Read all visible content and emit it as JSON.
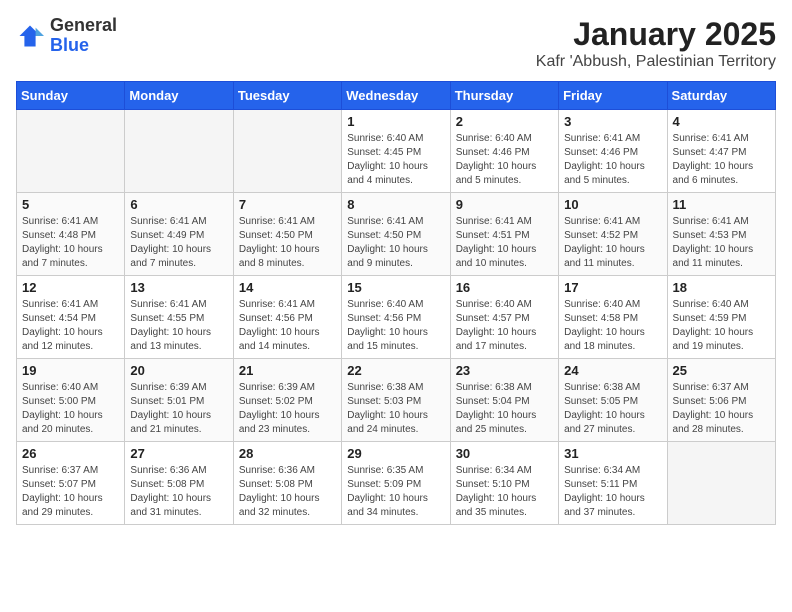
{
  "header": {
    "logo_line1": "General",
    "logo_line2": "Blue",
    "title": "January 2025",
    "subtitle": "Kafr 'Abbush, Palestinian Territory"
  },
  "weekdays": [
    "Sunday",
    "Monday",
    "Tuesday",
    "Wednesday",
    "Thursday",
    "Friday",
    "Saturday"
  ],
  "weeks": [
    [
      {
        "day": "",
        "info": ""
      },
      {
        "day": "",
        "info": ""
      },
      {
        "day": "",
        "info": ""
      },
      {
        "day": "1",
        "info": "Sunrise: 6:40 AM\nSunset: 4:45 PM\nDaylight: 10 hours\nand 4 minutes."
      },
      {
        "day": "2",
        "info": "Sunrise: 6:40 AM\nSunset: 4:46 PM\nDaylight: 10 hours\nand 5 minutes."
      },
      {
        "day": "3",
        "info": "Sunrise: 6:41 AM\nSunset: 4:46 PM\nDaylight: 10 hours\nand 5 minutes."
      },
      {
        "day": "4",
        "info": "Sunrise: 6:41 AM\nSunset: 4:47 PM\nDaylight: 10 hours\nand 6 minutes."
      }
    ],
    [
      {
        "day": "5",
        "info": "Sunrise: 6:41 AM\nSunset: 4:48 PM\nDaylight: 10 hours\nand 7 minutes."
      },
      {
        "day": "6",
        "info": "Sunrise: 6:41 AM\nSunset: 4:49 PM\nDaylight: 10 hours\nand 7 minutes."
      },
      {
        "day": "7",
        "info": "Sunrise: 6:41 AM\nSunset: 4:50 PM\nDaylight: 10 hours\nand 8 minutes."
      },
      {
        "day": "8",
        "info": "Sunrise: 6:41 AM\nSunset: 4:50 PM\nDaylight: 10 hours\nand 9 minutes."
      },
      {
        "day": "9",
        "info": "Sunrise: 6:41 AM\nSunset: 4:51 PM\nDaylight: 10 hours\nand 10 minutes."
      },
      {
        "day": "10",
        "info": "Sunrise: 6:41 AM\nSunset: 4:52 PM\nDaylight: 10 hours\nand 11 minutes."
      },
      {
        "day": "11",
        "info": "Sunrise: 6:41 AM\nSunset: 4:53 PM\nDaylight: 10 hours\nand 11 minutes."
      }
    ],
    [
      {
        "day": "12",
        "info": "Sunrise: 6:41 AM\nSunset: 4:54 PM\nDaylight: 10 hours\nand 12 minutes."
      },
      {
        "day": "13",
        "info": "Sunrise: 6:41 AM\nSunset: 4:55 PM\nDaylight: 10 hours\nand 13 minutes."
      },
      {
        "day": "14",
        "info": "Sunrise: 6:41 AM\nSunset: 4:56 PM\nDaylight: 10 hours\nand 14 minutes."
      },
      {
        "day": "15",
        "info": "Sunrise: 6:40 AM\nSunset: 4:56 PM\nDaylight: 10 hours\nand 15 minutes."
      },
      {
        "day": "16",
        "info": "Sunrise: 6:40 AM\nSunset: 4:57 PM\nDaylight: 10 hours\nand 17 minutes."
      },
      {
        "day": "17",
        "info": "Sunrise: 6:40 AM\nSunset: 4:58 PM\nDaylight: 10 hours\nand 18 minutes."
      },
      {
        "day": "18",
        "info": "Sunrise: 6:40 AM\nSunset: 4:59 PM\nDaylight: 10 hours\nand 19 minutes."
      }
    ],
    [
      {
        "day": "19",
        "info": "Sunrise: 6:40 AM\nSunset: 5:00 PM\nDaylight: 10 hours\nand 20 minutes."
      },
      {
        "day": "20",
        "info": "Sunrise: 6:39 AM\nSunset: 5:01 PM\nDaylight: 10 hours\nand 21 minutes."
      },
      {
        "day": "21",
        "info": "Sunrise: 6:39 AM\nSunset: 5:02 PM\nDaylight: 10 hours\nand 23 minutes."
      },
      {
        "day": "22",
        "info": "Sunrise: 6:38 AM\nSunset: 5:03 PM\nDaylight: 10 hours\nand 24 minutes."
      },
      {
        "day": "23",
        "info": "Sunrise: 6:38 AM\nSunset: 5:04 PM\nDaylight: 10 hours\nand 25 minutes."
      },
      {
        "day": "24",
        "info": "Sunrise: 6:38 AM\nSunset: 5:05 PM\nDaylight: 10 hours\nand 27 minutes."
      },
      {
        "day": "25",
        "info": "Sunrise: 6:37 AM\nSunset: 5:06 PM\nDaylight: 10 hours\nand 28 minutes."
      }
    ],
    [
      {
        "day": "26",
        "info": "Sunrise: 6:37 AM\nSunset: 5:07 PM\nDaylight: 10 hours\nand 29 minutes."
      },
      {
        "day": "27",
        "info": "Sunrise: 6:36 AM\nSunset: 5:08 PM\nDaylight: 10 hours\nand 31 minutes."
      },
      {
        "day": "28",
        "info": "Sunrise: 6:36 AM\nSunset: 5:08 PM\nDaylight: 10 hours\nand 32 minutes."
      },
      {
        "day": "29",
        "info": "Sunrise: 6:35 AM\nSunset: 5:09 PM\nDaylight: 10 hours\nand 34 minutes."
      },
      {
        "day": "30",
        "info": "Sunrise: 6:34 AM\nSunset: 5:10 PM\nDaylight: 10 hours\nand 35 minutes."
      },
      {
        "day": "31",
        "info": "Sunrise: 6:34 AM\nSunset: 5:11 PM\nDaylight: 10 hours\nand 37 minutes."
      },
      {
        "day": "",
        "info": ""
      }
    ]
  ]
}
